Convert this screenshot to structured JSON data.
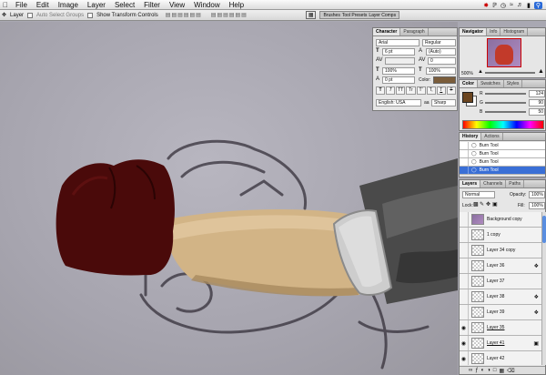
{
  "menubar": {
    "apple": "",
    "items": [
      "File",
      "Edit",
      "Image",
      "Layer",
      "Select",
      "Filter",
      "View",
      "Window",
      "Help"
    ]
  },
  "options": {
    "tool_label": "Layer",
    "auto_select": "Auto Select Groups",
    "show_transform": "Show Transform Controls",
    "tabs": [
      "Brushes",
      "Tool Presets",
      "Layer Comps"
    ]
  },
  "character": {
    "tabs": [
      "Character",
      "Paragraph"
    ],
    "font": "Arial",
    "style": "Regular",
    "size": "6 pt",
    "leading": "(Auto)",
    "kerning": "",
    "tracking": "0",
    "vscale": "100%",
    "hscale": "100%",
    "baseline": "0 pt",
    "color_label": "Color:",
    "color": "#7a5c3a",
    "style_buttons": [
      "T",
      "T",
      "TT",
      "Tr",
      "T'",
      "T,",
      "T",
      "T"
    ],
    "language": "English: USA",
    "aa_label": "aa",
    "antialias": "Sharp"
  },
  "navigator": {
    "tabs": [
      "Navigator",
      "Info",
      "Histogram"
    ],
    "zoom": "500%"
  },
  "color": {
    "tabs": [
      "Color",
      "Swatches",
      "Styles"
    ],
    "r": "124",
    "g": "90",
    "b": "50",
    "fg": "#6b4520",
    "bg": "#ffffff"
  },
  "history": {
    "tabs": [
      "History",
      "Actions"
    ],
    "items": [
      "Burn Tool",
      "Burn Tool",
      "Burn Tool",
      "Burn Tool"
    ]
  },
  "layers": {
    "tabs": [
      "Layers",
      "Channels",
      "Paths"
    ],
    "blend": "Normal",
    "opacity_label": "Opacity:",
    "opacity": "100%",
    "lock_label": "Lock:",
    "fill_label": "Fill:",
    "fill": "100%",
    "rows": [
      "Background copy",
      "1 copy",
      "Layer 34 copy",
      "Layer 36",
      "Layer 37",
      "Layer 38",
      "Layer 39",
      "Layer 35",
      "Layer 41",
      "Layer 42"
    ]
  },
  "colors": {
    "glove": "#4a0a0a",
    "arm": "#d2b486",
    "cuff": "#c8c8c8",
    "sleeve": "#3a3a3a",
    "sketch": "#35303a"
  }
}
